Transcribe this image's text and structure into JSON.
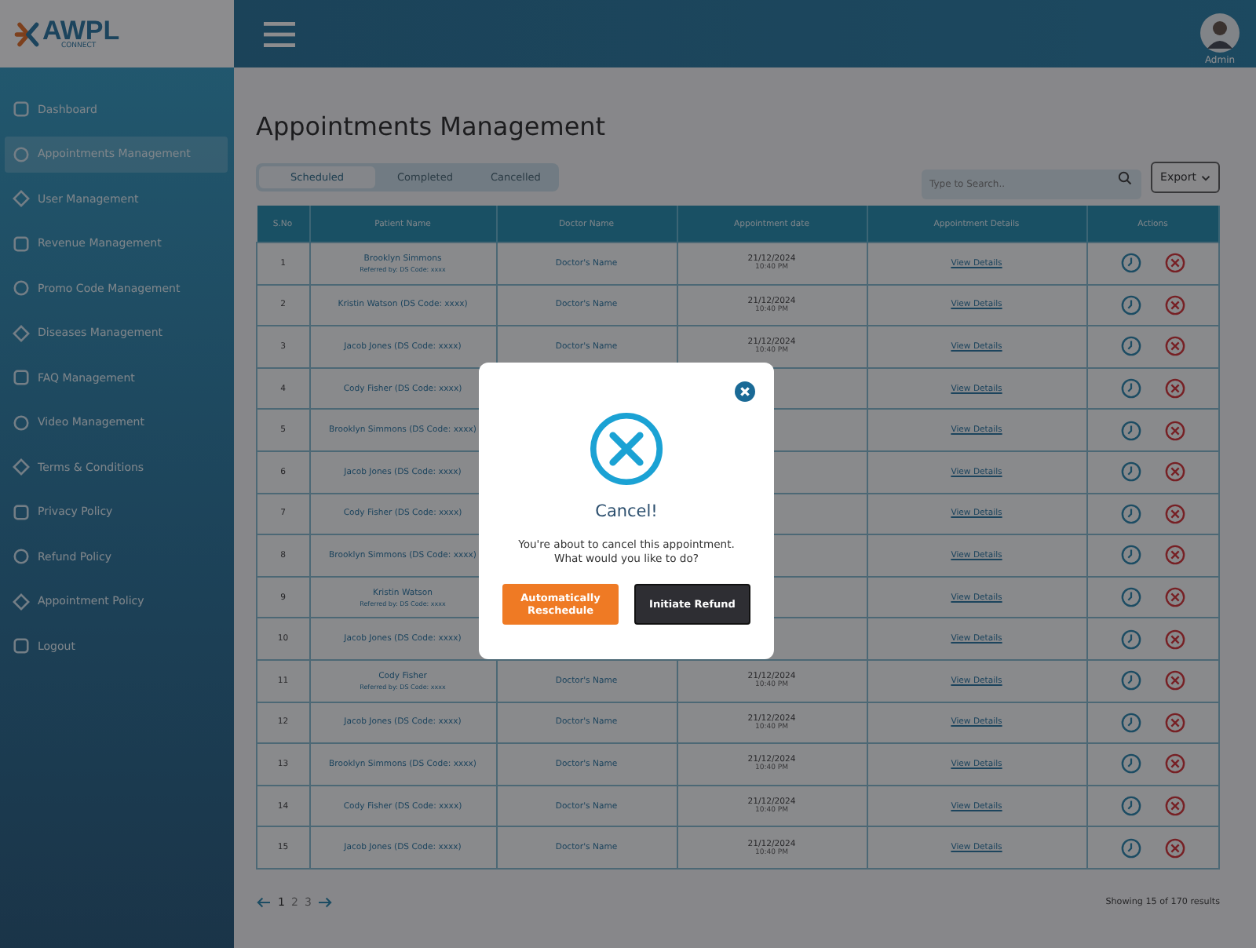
{
  "logo": {
    "name": "AWPL",
    "sub": "CONNECT"
  },
  "header": {
    "user": "Admin"
  },
  "sidebar": {
    "items": [
      {
        "label": "Dashboard",
        "selected": false
      },
      {
        "label": "Appointments Management",
        "selected": true
      },
      {
        "label": "User Management",
        "selected": false
      },
      {
        "label": "Revenue Management",
        "selected": false
      },
      {
        "label": "Promo Code Management",
        "selected": false
      },
      {
        "label": "Diseases Management",
        "selected": false
      },
      {
        "label": "FAQ Management",
        "selected": false
      },
      {
        "label": "Video Management",
        "selected": false
      },
      {
        "label": "Terms & Conditions",
        "selected": false
      },
      {
        "label": "Privacy Policy",
        "selected": false
      },
      {
        "label": "Refund Policy",
        "selected": false
      },
      {
        "label": "Appointment Policy",
        "selected": false
      },
      {
        "label": "Logout",
        "selected": false
      }
    ]
  },
  "page_title": "Appointments Management",
  "tabs": [
    {
      "label": "Scheduled",
      "selected": true
    },
    {
      "label": "Completed",
      "selected": false
    },
    {
      "label": "Cancelled",
      "selected": false
    }
  ],
  "search": {
    "placeholder": "Type to Search.."
  },
  "export": "Export",
  "table": {
    "columns": [
      "S.No",
      "Patient Name",
      "Doctor Name",
      "Appointment date",
      "Appointment Details",
      "Actions"
    ],
    "rows": [
      {
        "sno": "1",
        "patient": "Brooklyn Simmons",
        "referred": "Referred by: DS Code: xxxx",
        "doctor": "Doctor's Name",
        "date": "21/12/2024",
        "time": "10:40 PM",
        "details": "View Details"
      },
      {
        "sno": "2",
        "patient": "Kristin Watson (DS Code: xxxx)",
        "doctor": "Doctor's Name",
        "date": "21/12/2024",
        "time": "10:40 PM",
        "details": "View Details"
      },
      {
        "sno": "3",
        "patient": "Jacob Jones (DS Code: xxxx)",
        "doctor": "Doctor's Name",
        "date": "21/12/2024",
        "time": "10:40 PM",
        "details": "View Details"
      },
      {
        "sno": "4",
        "patient": "Cody Fisher (DS Code: xxxx)",
        "details": "View Details"
      },
      {
        "sno": "5",
        "patient": "Brooklyn Simmons (DS Code: xxxx)",
        "details": "View Details"
      },
      {
        "sno": "6",
        "patient": "Jacob Jones (DS Code: xxxx)",
        "details": "View Details"
      },
      {
        "sno": "7",
        "patient": "Cody Fisher (DS Code: xxxx)",
        "details": "View Details"
      },
      {
        "sno": "8",
        "patient": "Brooklyn Simmons (DS Code: xxxx)",
        "details": "View Details"
      },
      {
        "sno": "9",
        "patient": "Kristin Watson",
        "referred": "Referred by: DS Code: xxxx",
        "details": "View Details"
      },
      {
        "sno": "10",
        "patient": "Jacob Jones (DS Code: xxxx)",
        "details": "View Details"
      },
      {
        "sno": "11",
        "patient": "Cody Fisher",
        "referred": "Referred by: DS Code: xxxx",
        "doctor": "Doctor's Name",
        "date": "21/12/2024",
        "time": "10:40 PM",
        "details": "View Details"
      },
      {
        "sno": "12",
        "patient": "Jacob Jones (DS Code: xxxx)",
        "doctor": "Doctor's Name",
        "date": "21/12/2024",
        "time": "10:40 PM",
        "details": "View Details"
      },
      {
        "sno": "13",
        "patient": "Brooklyn Simmons (DS Code: xxxx)",
        "doctor": "Doctor's Name",
        "date": "21/12/2024",
        "time": "10:40 PM",
        "details": "View Details"
      },
      {
        "sno": "14",
        "patient": "Cody Fisher (DS Code: xxxx)",
        "doctor": "Doctor's Name",
        "date": "21/12/2024",
        "time": "10:40 PM",
        "details": "View Details"
      },
      {
        "sno": "15",
        "patient": "Jacob Jones (DS Code: xxxx)",
        "doctor": "Doctor's Name",
        "date": "21/12/2024",
        "time": "10:40 PM",
        "details": "View Details"
      }
    ]
  },
  "pagination": {
    "pages": [
      {
        "label": "1",
        "selected": true
      },
      {
        "label": "2",
        "selected": false
      },
      {
        "label": "3",
        "selected": false
      }
    ],
    "results": "Showing 15 of 170 results"
  },
  "modal": {
    "title": "Cancel!",
    "message": "You're about to cancel this appointment. What would you like to do?",
    "buttons": [
      {
        "label": "Automatically Reschedule",
        "kind": "primary"
      },
      {
        "label": "Initiate Refund",
        "kind": "dark"
      }
    ]
  }
}
